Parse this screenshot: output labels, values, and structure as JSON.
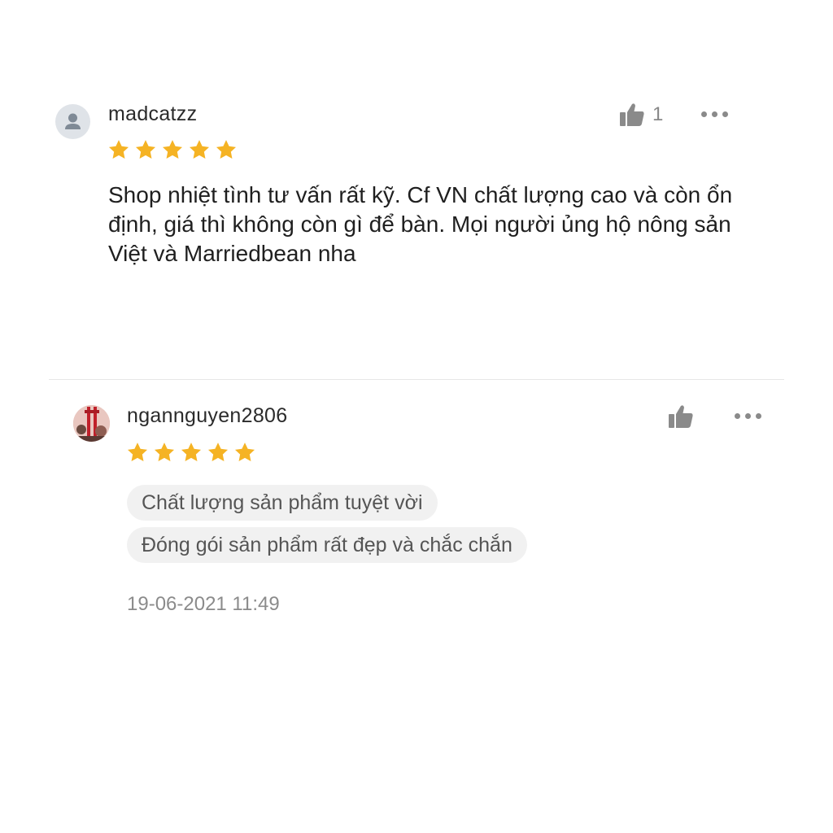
{
  "reviews": [
    {
      "username": "madcatzz",
      "avatar": "default-user-icon",
      "rating": 5,
      "likes": "1",
      "comment": "Shop nhiệt tình tư vấn rất kỹ. Cf VN chất lượng cao và còn ổn định, giá thì không còn gì để bàn. Mọi người ủng hộ nông sản Việt và Marriedbean nha"
    },
    {
      "username": "ngannguyen2806",
      "avatar": "profile-photo",
      "rating": 5,
      "likes": "",
      "tags": [
        "Chất lượng sản phẩm tuyệt vời",
        "Đóng gói sản phẩm rất đẹp và chắc chắn"
      ],
      "timestamp": "19-06-2021 11:49"
    }
  ],
  "colors": {
    "star": "#F5B324",
    "icon_gray": "#8a8a8a",
    "tag_bg": "#f1f1f1"
  }
}
